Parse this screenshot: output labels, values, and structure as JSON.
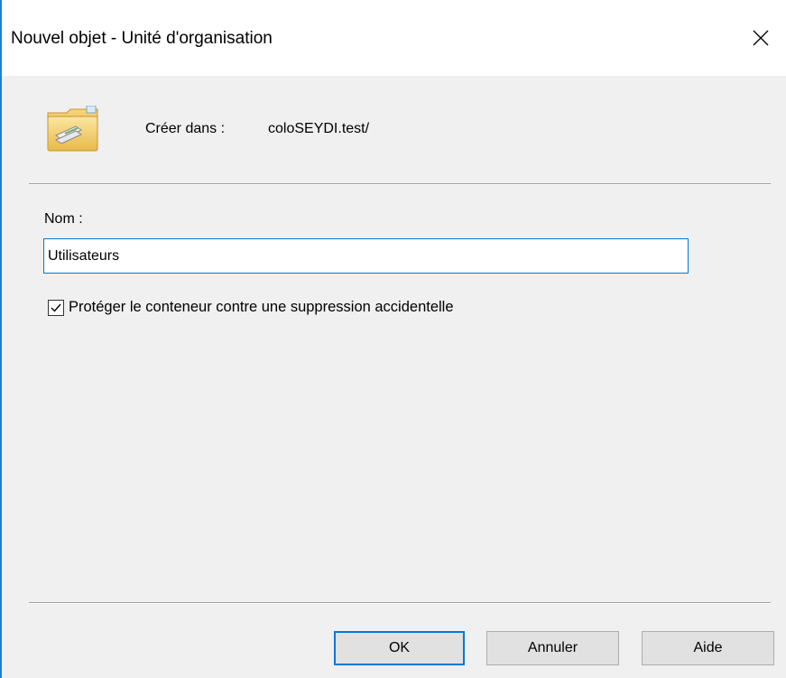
{
  "window": {
    "title": "Nouvel objet - Unité d'organisation",
    "close_symbol": "✕"
  },
  "header": {
    "icon": "organizational-unit-folder-icon",
    "create_in_label": "Créer dans :",
    "create_in_value": "coloSEYDI.test/"
  },
  "form": {
    "name_label": "Nom :",
    "name_value": "Utilisateurs",
    "protect_checkbox_label": "Protéger le conteneur contre une suppression accidentelle",
    "protect_checked": true
  },
  "buttons": {
    "ok": "OK",
    "cancel": "Annuler",
    "help": "Aide"
  },
  "colors": {
    "accent": "#0078d7",
    "dialog_background": "#f0f0f0"
  }
}
